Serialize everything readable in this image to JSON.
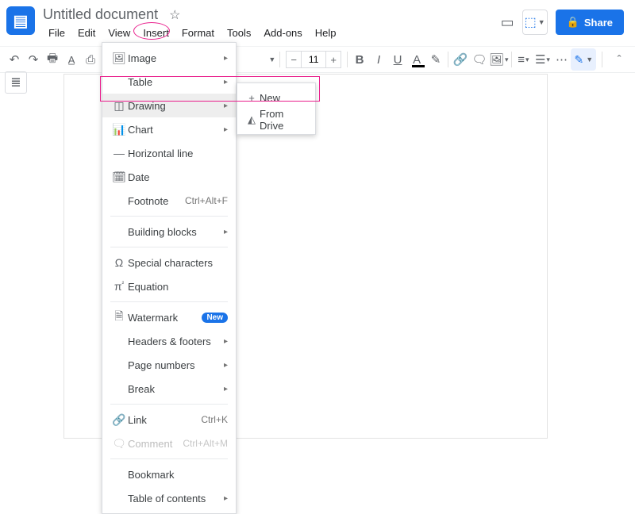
{
  "header": {
    "doc_title": "Untitled document",
    "share_label": "Share"
  },
  "menu_bar": {
    "file": "File",
    "edit": "Edit",
    "view": "View",
    "insert": "Insert",
    "format": "Format",
    "tools": "Tools",
    "addons": "Add-ons",
    "help": "Help"
  },
  "toolbar": {
    "font_size": "11"
  },
  "insert_menu": {
    "image": "Image",
    "table": "Table",
    "drawing": "Drawing",
    "chart": "Chart",
    "horizontal_line": "Horizontal line",
    "date": "Date",
    "footnote": "Footnote",
    "footnote_shortcut": "Ctrl+Alt+F",
    "building_blocks": "Building blocks",
    "special_characters": "Special characters",
    "equation": "Equation",
    "watermark": "Watermark",
    "watermark_badge": "New",
    "headers_footers": "Headers & footers",
    "page_numbers": "Page numbers",
    "break": "Break",
    "link": "Link",
    "link_shortcut": "Ctrl+K",
    "comment": "Comment",
    "comment_shortcut": "Ctrl+Alt+M",
    "bookmark": "Bookmark",
    "toc": "Table of contents"
  },
  "drawing_submenu": {
    "new": "New",
    "from_drive": "From Drive"
  }
}
